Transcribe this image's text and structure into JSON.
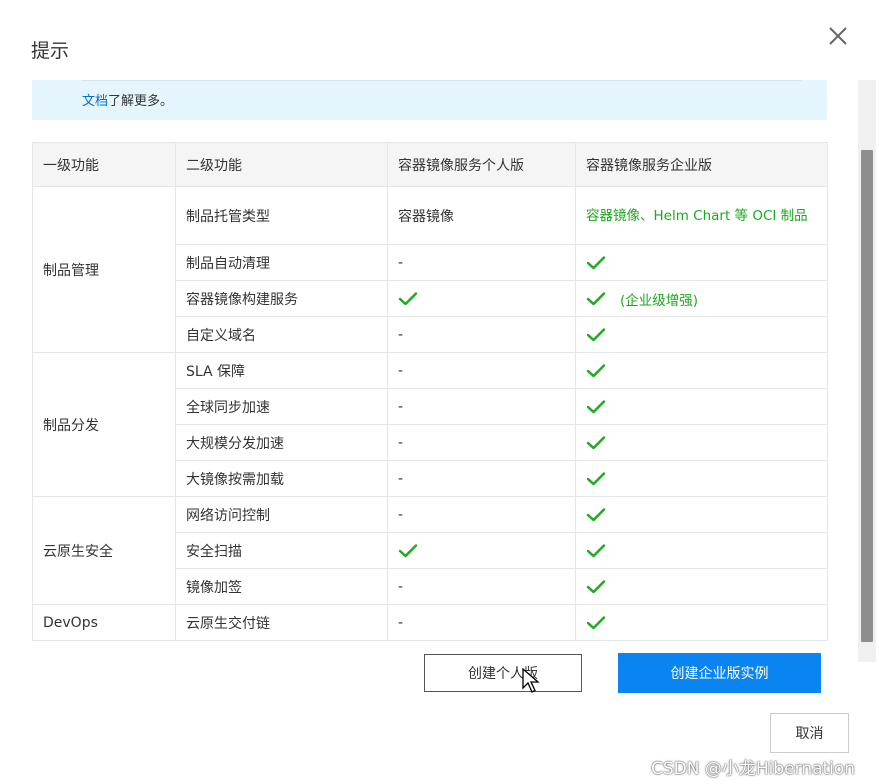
{
  "dialog": {
    "title": "提示",
    "close_icon": "close-icon"
  },
  "notice": {
    "link_text": "文档",
    "text_after_link": "了解更多。"
  },
  "table": {
    "headers": [
      "一级功能",
      "二级功能",
      "容器镜像服务个人版",
      "容器镜像服务企业版"
    ],
    "groups": [
      {
        "name": "制品管理",
        "rows": [
          {
            "feature": "制品托管类型",
            "personal": "容器镜像",
            "enterprise": "容器镜像、Helm Chart 等 OCI 制品"
          },
          {
            "feature": "制品自动清理",
            "personal": "-",
            "enterprise": "check"
          },
          {
            "feature": "容器镜像构建服务",
            "personal": "check",
            "enterprise": "check",
            "enterprise_note": "(企业级增强)"
          },
          {
            "feature": "自定义域名",
            "personal": "-",
            "enterprise": "check"
          }
        ]
      },
      {
        "name": "制品分发",
        "rows": [
          {
            "feature": "SLA 保障",
            "personal": "-",
            "enterprise": "check"
          },
          {
            "feature": "全球同步加速",
            "personal": "-",
            "enterprise": "check"
          },
          {
            "feature": "大规模分发加速",
            "personal": "-",
            "enterprise": "check"
          },
          {
            "feature": "大镜像按需加载",
            "personal": "-",
            "enterprise": "check"
          }
        ]
      },
      {
        "name": "云原生安全",
        "rows": [
          {
            "feature": "网络访问控制",
            "personal": "-",
            "enterprise": "check"
          },
          {
            "feature": "安全扫描",
            "personal": "check",
            "enterprise": "check"
          },
          {
            "feature": "镜像加签",
            "personal": "-",
            "enterprise": "check"
          }
        ]
      },
      {
        "name": "DevOps",
        "rows": [
          {
            "feature": "云原生交付链",
            "personal": "-",
            "enterprise": "check"
          }
        ]
      }
    ]
  },
  "buttons": {
    "create_personal": "创建个人版",
    "create_enterprise": "创建企业版实例",
    "cancel": "取消"
  },
  "watermark": "CSDN @小龙Hibernation",
  "colors": {
    "check": "#1ca91c",
    "primary": "#0a84f0",
    "notice_bg": "#e5f5fd",
    "link": "#0070cc"
  }
}
